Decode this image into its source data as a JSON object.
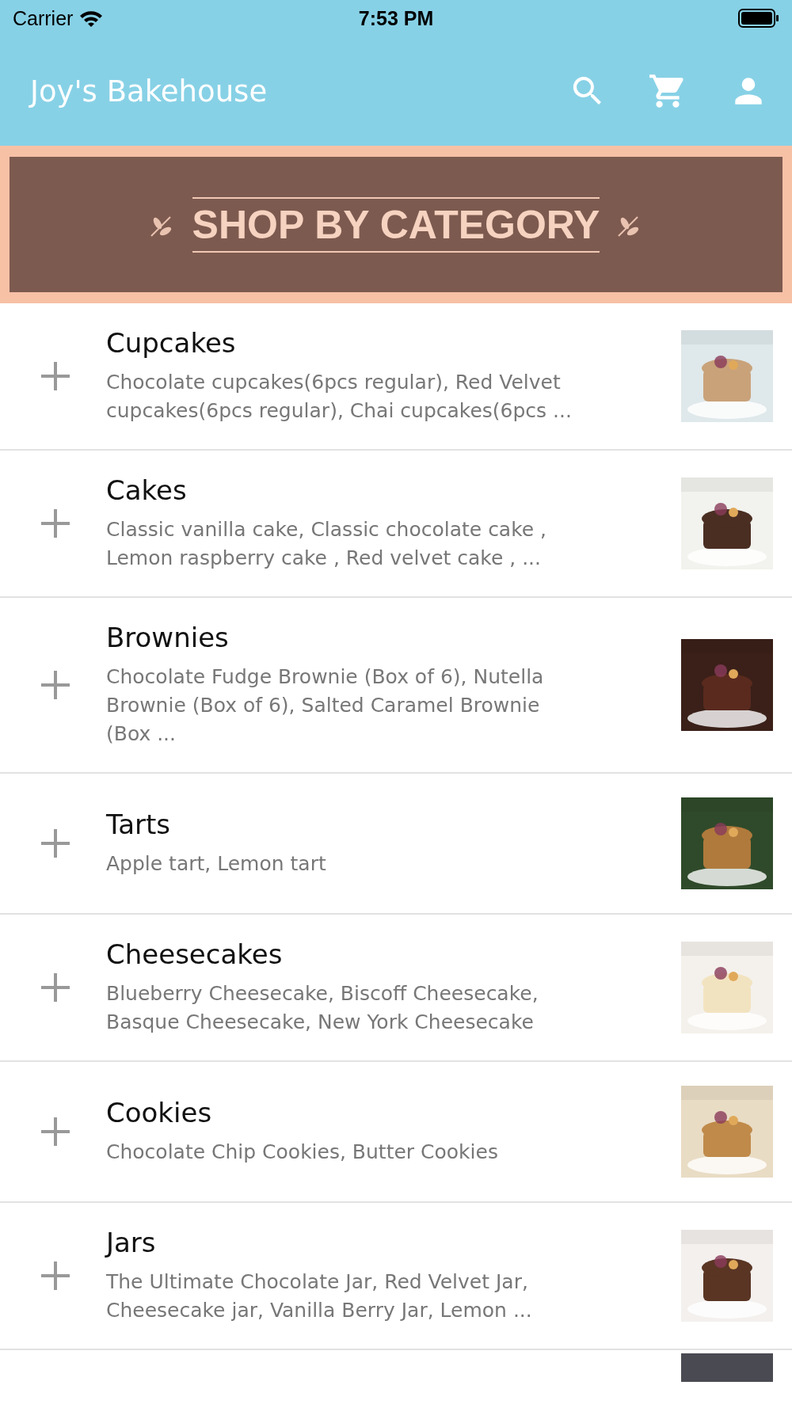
{
  "status_bar": {
    "carrier": "Carrier",
    "time": "7:53 PM"
  },
  "app_bar": {
    "title": "Joy's Bakehouse"
  },
  "banner": {
    "title": "SHOP BY CATEGORY"
  },
  "categories": [
    {
      "title": "Cupcakes",
      "description": "Chocolate cupcakes(6pcs regular), Red Velvet cupcakes(6pcs regular), Chai cupcakes(6pcs ...",
      "expanded": false
    },
    {
      "title": "Cakes",
      "description": "Classic vanilla cake, Classic chocolate cake , Lemon raspberry cake , Red velvet cake , ...",
      "expanded": false
    },
    {
      "title": "Brownies",
      "description": "Chocolate Fudge Brownie (Box of 6), Nutella Brownie (Box of 6), Salted Caramel Brownie (Box ...",
      "expanded": false
    },
    {
      "title": "Tarts",
      "description": "Apple tart, Lemon tart",
      "expanded": false
    },
    {
      "title": "Cheesecakes",
      "description": "Blueberry Cheesecake, Biscoff Cheesecake, Basque Cheesecake, New York Cheesecake",
      "expanded": false
    },
    {
      "title": "Cookies",
      "description": "Chocolate Chip Cookies, Butter Cookies",
      "expanded": false
    },
    {
      "title": "Jars",
      "description": "The Ultimate Chocolate Jar, Red Velvet Jar, Cheesecake jar, Vanilla Berry Jar, Lemon ...",
      "expanded": false
    }
  ]
}
